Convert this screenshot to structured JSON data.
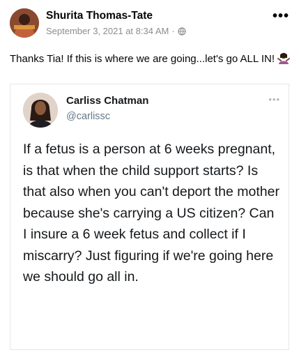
{
  "post": {
    "author_name": "Shurita Thomas-Tate",
    "timestamp": "September 3, 2021 at 8:34 AM",
    "separator": "·",
    "privacy_icon": "globe-icon",
    "more_label": "•••",
    "caption": "Thanks Tia! If this is where we are going...let's go ALL IN!",
    "caption_emoji_icon": "woman-gesturing-icon"
  },
  "tweet": {
    "author_name": "Carliss Chatman",
    "handle": "@carlissc",
    "more_label": "•••",
    "text": "If a fetus is a person at 6 weeks pregnant, is that when the child support starts? Is that also when you can't deport the mother because she's carrying a US citizen? Can I insure a 6 week fetus and collect if I miscarry? Just figuring if we're going here we should go all in."
  },
  "colors": {
    "name_text": "#050505",
    "meta_text": "#8a8d91",
    "tweet_handle": "#657786",
    "tweet_border": "#e6e6e6"
  }
}
